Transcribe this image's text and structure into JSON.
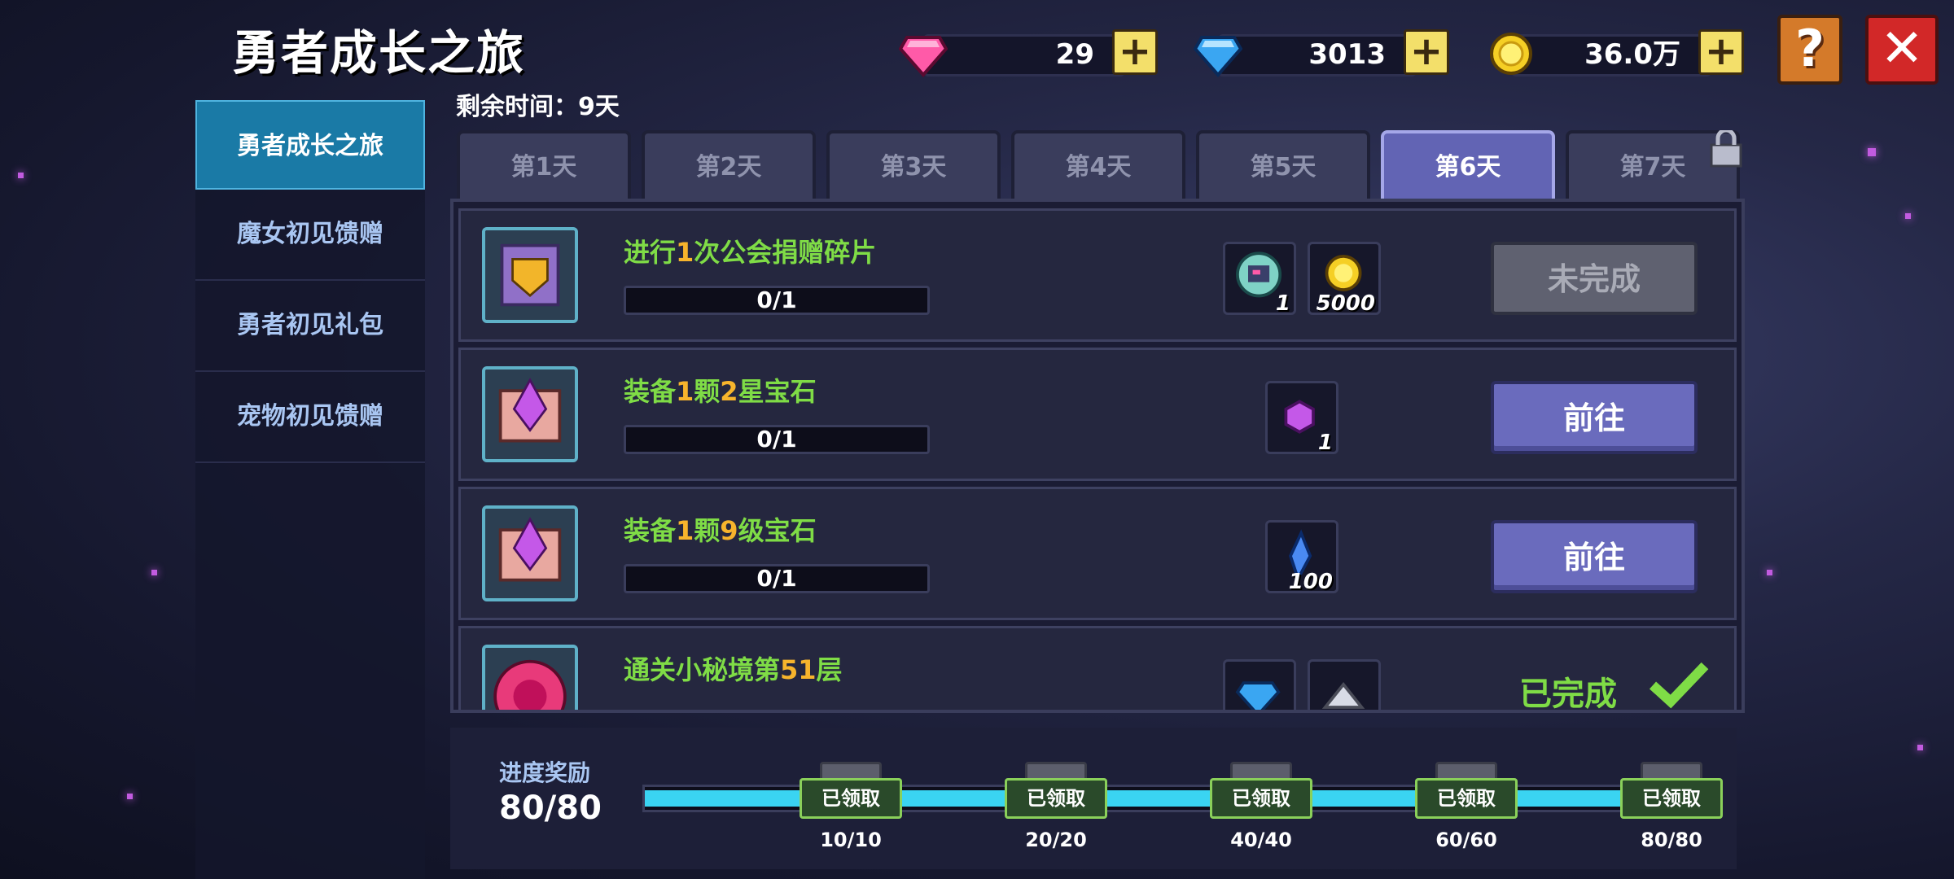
{
  "header": {
    "title": "勇者成长之旅"
  },
  "resources": [
    {
      "icon": "pink-gem-icon",
      "value": "29"
    },
    {
      "icon": "blue-diamond-icon",
      "value": "3013"
    },
    {
      "icon": "gold-coin-icon",
      "value": "36.0万"
    }
  ],
  "buttons": {
    "help": "?",
    "close": "✕",
    "plus": "+"
  },
  "sidebar": {
    "items": [
      {
        "label": "勇者成长之旅",
        "active": true
      },
      {
        "label": "魔女初见馈赠",
        "active": false
      },
      {
        "label": "勇者初见礼包",
        "active": false
      },
      {
        "label": "宠物初见馈赠",
        "active": false
      }
    ]
  },
  "remaining": "剩余时间：9天",
  "tabs": [
    {
      "label": "第1天"
    },
    {
      "label": "第2天"
    },
    {
      "label": "第3天"
    },
    {
      "label": "第4天"
    },
    {
      "label": "第5天"
    },
    {
      "label": "第6天",
      "active": true
    },
    {
      "label": "第7天",
      "locked": true
    }
  ],
  "tasks": [
    {
      "name_parts": [
        "进行",
        "1",
        "次公会捐赠碎片"
      ],
      "progress": "0/1",
      "rewards": [
        {
          "icon": "guild-fragment-icon",
          "count": "1"
        },
        {
          "icon": "gold-coin-icon",
          "count": "5000"
        }
      ],
      "status": "未完成"
    },
    {
      "name_parts": [
        "装备",
        "1",
        "颗",
        "2",
        "星宝石"
      ],
      "progress": "0/1",
      "rewards": [
        {
          "icon": "purple-gem-icon",
          "count": "1"
        }
      ],
      "status": "前往"
    },
    {
      "name_parts": [
        "装备",
        "1",
        "颗",
        "9",
        "级宝石"
      ],
      "progress": "0/1",
      "rewards": [
        {
          "icon": "blue-crystal-icon",
          "count": "100"
        }
      ],
      "status": "前往"
    },
    {
      "name_parts": [
        "通关小秘境第",
        "51",
        "层"
      ],
      "progress": "",
      "rewards": [
        {
          "icon": "blue-diamond-icon",
          "count": ""
        },
        {
          "icon": "silver-ore-icon",
          "count": ""
        }
      ],
      "status": "已完成"
    }
  ],
  "progress_rewards": {
    "label": "进度奖励",
    "total": "80/80",
    "fill_fraction": 1.0,
    "claim_label": "已领取",
    "milestones": [
      "10/10",
      "20/20",
      "40/40",
      "60/60",
      "80/80"
    ]
  },
  "colors": {
    "accent_green": "#7fdc46",
    "highlight_orange": "#f7b42c",
    "active_tab": "#6264b4",
    "sidebar_active": "#1a7aa6"
  }
}
